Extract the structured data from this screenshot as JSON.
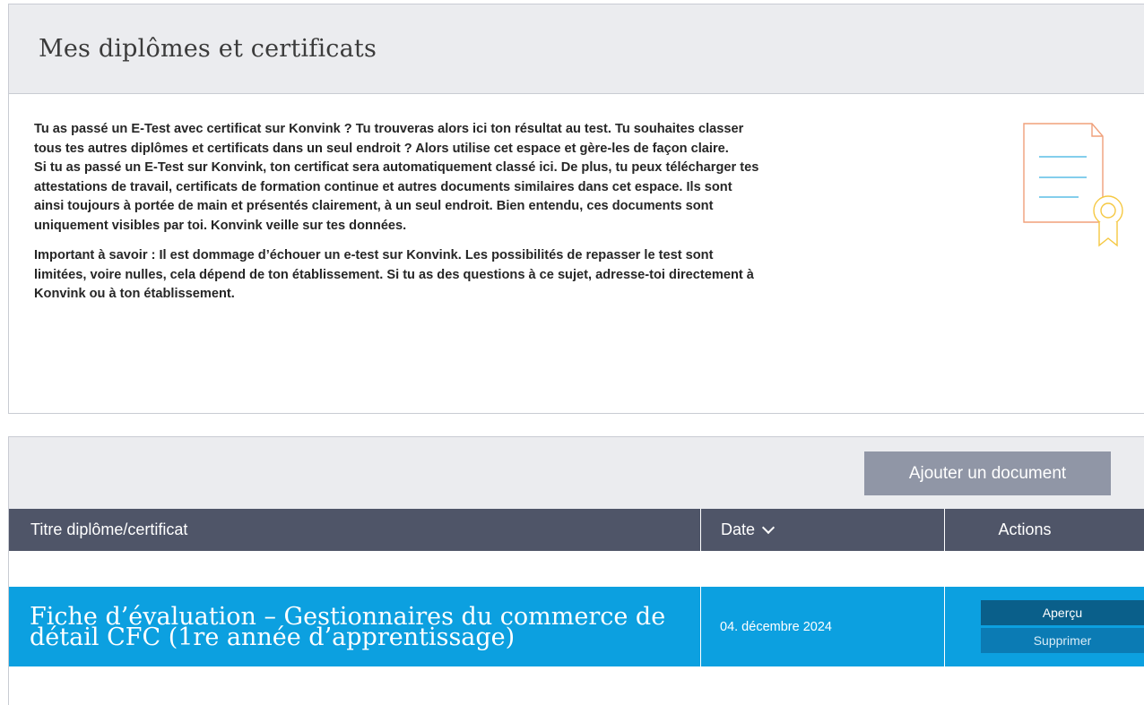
{
  "page": {
    "title": "Mes diplômes et certificats"
  },
  "intro": {
    "paragraph1": "Tu as passé un E-Test avec certificat sur Konvink ? Tu trouveras alors ici ton résultat au test. Tu souhaites classer tous tes autres diplômes et certificats dans un seul endroit ? Alors utilise cet espace et gère-les de façon claire.",
    "paragraph2": "Si tu as passé un E-Test sur Konvink, ton certificat sera automatiquement classé ici. De plus, tu peux télécharger tes attestations de travail, certificats de formation continue et autres documents similaires dans cet espace. Ils sont ainsi toujours à portée de main et présentés clairement, à un seul endroit. Bien entendu, ces documents sont uniquement visibles par toi. Konvink veille sur tes données.",
    "paragraph3": "Important à savoir : Il est dommage d’échouer un e-test sur Konvink. Les possibilités de repasser le test sont limitées, voire nulles, cela dépend de ton établissement. Si tu as des questions à ce sujet, adresse-toi directement à Konvink ou à ton établissement."
  },
  "illustration": {
    "icon": "certificate-document-icon",
    "colors": {
      "document": "#f0a07a",
      "lines": "#5bbde6",
      "ribbon": "#f5c842"
    }
  },
  "toolbar": {
    "add_label": "Ajouter un document"
  },
  "table": {
    "columns": {
      "title": "Titre diplôme/certificat",
      "date": "Date",
      "actions": "Actions"
    },
    "sort_icon": "chevron-down-icon",
    "rows": [
      {
        "title": "Fiche d’évaluation – Gestionnaires du commerce de détail CFC (1re année d’apprentissage)",
        "date": "04. décembre 2024",
        "preview_label": "Aperçu",
        "delete_label": "Supprimer"
      }
    ]
  },
  "colors": {
    "header_bg": "#ebecef",
    "table_head": "#4f5568",
    "row_selected": "#0ca0e0",
    "button_primary": "#9096a6",
    "button_preview": "#0a5f8a",
    "button_delete": "#0b7bb4"
  }
}
